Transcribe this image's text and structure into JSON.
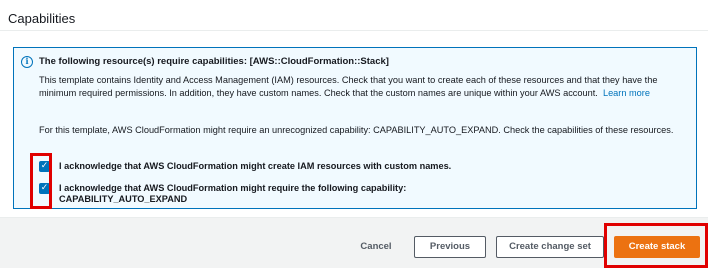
{
  "section": {
    "title": "Capabilities"
  },
  "alert": {
    "icon": "info-icon",
    "title": "The following resource(s) require capabilities: [AWS::CloudFormation::Stack]",
    "para1": "This template contains Identity and Access Management (IAM) resources. Check that you want to create each of these resources and that they have the minimum required permissions. In addition, they have custom names. Check that the custom names are unique within your AWS account.",
    "learn_more": "Learn more",
    "para2": "For this template, AWS CloudFormation might require an unrecognized capability: CAPABILITY_AUTO_EXPAND. Check the capabilities of these resources.",
    "ack1": "I acknowledge that AWS CloudFormation might create IAM resources with custom names.",
    "ack2_line1": "I acknowledge that AWS CloudFormation might require the following capability:",
    "ack2_line2": "CAPABILITY_AUTO_EXPAND",
    "ack1_checked": true,
    "ack2_checked": true
  },
  "footer": {
    "cancel": "Cancel",
    "previous": "Previous",
    "create_change_set": "Create change set",
    "create_stack": "Create stack"
  },
  "colors": {
    "accent": "#0073bb",
    "primary_button": "#ec7211",
    "highlight": "#e00000",
    "alert_bg": "#f1faff"
  }
}
